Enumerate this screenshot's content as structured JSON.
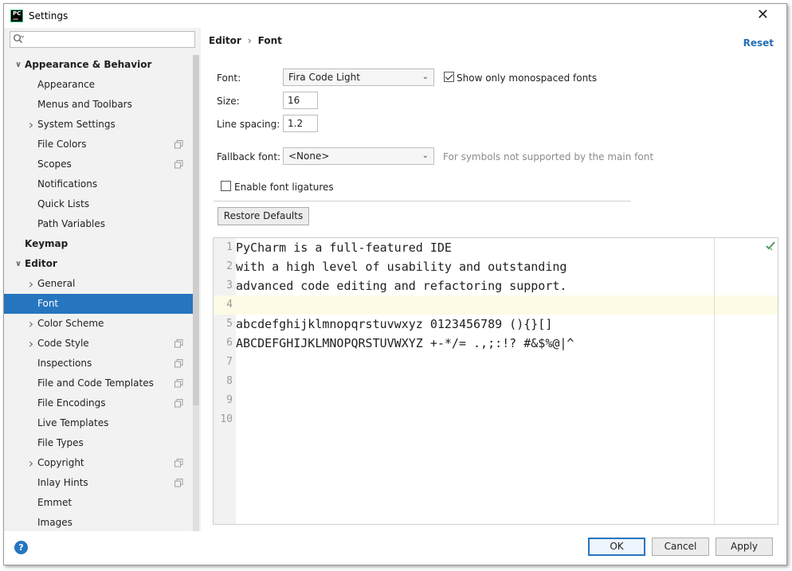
{
  "window": {
    "title": "Settings"
  },
  "sidebar": {
    "search_placeholder": "",
    "items": [
      {
        "label": "Appearance & Behavior",
        "level": 0,
        "expand": "open"
      },
      {
        "label": "Appearance",
        "level": 1
      },
      {
        "label": "Menus and Toolbars",
        "level": 1
      },
      {
        "label": "System Settings",
        "level": 1,
        "expand": "closed"
      },
      {
        "label": "File Colors",
        "level": 1,
        "project_icon": true
      },
      {
        "label": "Scopes",
        "level": 1,
        "project_icon": true
      },
      {
        "label": "Notifications",
        "level": 1
      },
      {
        "label": "Quick Lists",
        "level": 1
      },
      {
        "label": "Path Variables",
        "level": 1
      },
      {
        "label": "Keymap",
        "level": 0
      },
      {
        "label": "Editor",
        "level": 0,
        "expand": "open"
      },
      {
        "label": "General",
        "level": 1,
        "expand": "closed"
      },
      {
        "label": "Font",
        "level": 1,
        "selected": true
      },
      {
        "label": "Color Scheme",
        "level": 1,
        "expand": "closed"
      },
      {
        "label": "Code Style",
        "level": 1,
        "expand": "closed",
        "project_icon": true
      },
      {
        "label": "Inspections",
        "level": 1,
        "project_icon": true
      },
      {
        "label": "File and Code Templates",
        "level": 1,
        "project_icon": true
      },
      {
        "label": "File Encodings",
        "level": 1,
        "project_icon": true
      },
      {
        "label": "Live Templates",
        "level": 1
      },
      {
        "label": "File Types",
        "level": 1
      },
      {
        "label": "Copyright",
        "level": 1,
        "expand": "closed",
        "project_icon": true
      },
      {
        "label": "Inlay Hints",
        "level": 1,
        "project_icon": true
      },
      {
        "label": "Emmet",
        "level": 1
      },
      {
        "label": "Images",
        "level": 1
      }
    ]
  },
  "breadcrumb": {
    "parent": "Editor",
    "current": "Font"
  },
  "reset_label": "Reset",
  "form": {
    "font_label": "Font:",
    "font_value": "Fira Code Light",
    "monospaced_label": "Show only monospaced fonts",
    "monospaced_checked": true,
    "size_label": "Size:",
    "size_value": "16",
    "spacing_label": "Line spacing:",
    "spacing_value": "1.2",
    "fallback_label": "Fallback font:",
    "fallback_value": "<None>",
    "fallback_hint": "For symbols not supported by the main font",
    "ligatures_label": "Enable font ligatures",
    "ligatures_checked": false,
    "restore_label": "Restore Defaults"
  },
  "preview": {
    "lines": [
      {
        "num": "1",
        "text": "PyCharm is a full-featured IDE"
      },
      {
        "num": "2",
        "text": "with a high level of usability and outstanding"
      },
      {
        "num": "3",
        "text": "advanced code editing and refactoring support."
      },
      {
        "num": "4",
        "text": ""
      },
      {
        "num": "5",
        "text": "abcdefghijklmnopqrstuvwxyz 0123456789 (){}[]"
      },
      {
        "num": "6",
        "text": "ABCDEFGHIJKLMNOPQRSTUVWXYZ +-*/= .,;:!? #&$%@|^"
      },
      {
        "num": "7",
        "text": ""
      },
      {
        "num": "8",
        "text": ""
      },
      {
        "num": "9",
        "text": ""
      },
      {
        "num": "10",
        "text": ""
      }
    ],
    "current_line": 4
  },
  "buttons": {
    "ok": "OK",
    "cancel": "Cancel",
    "apply": "Apply"
  },
  "help_label": "?",
  "colors": {
    "selection": "#2675bf",
    "link": "#2470b3",
    "current_line": "#fdfbe6"
  }
}
